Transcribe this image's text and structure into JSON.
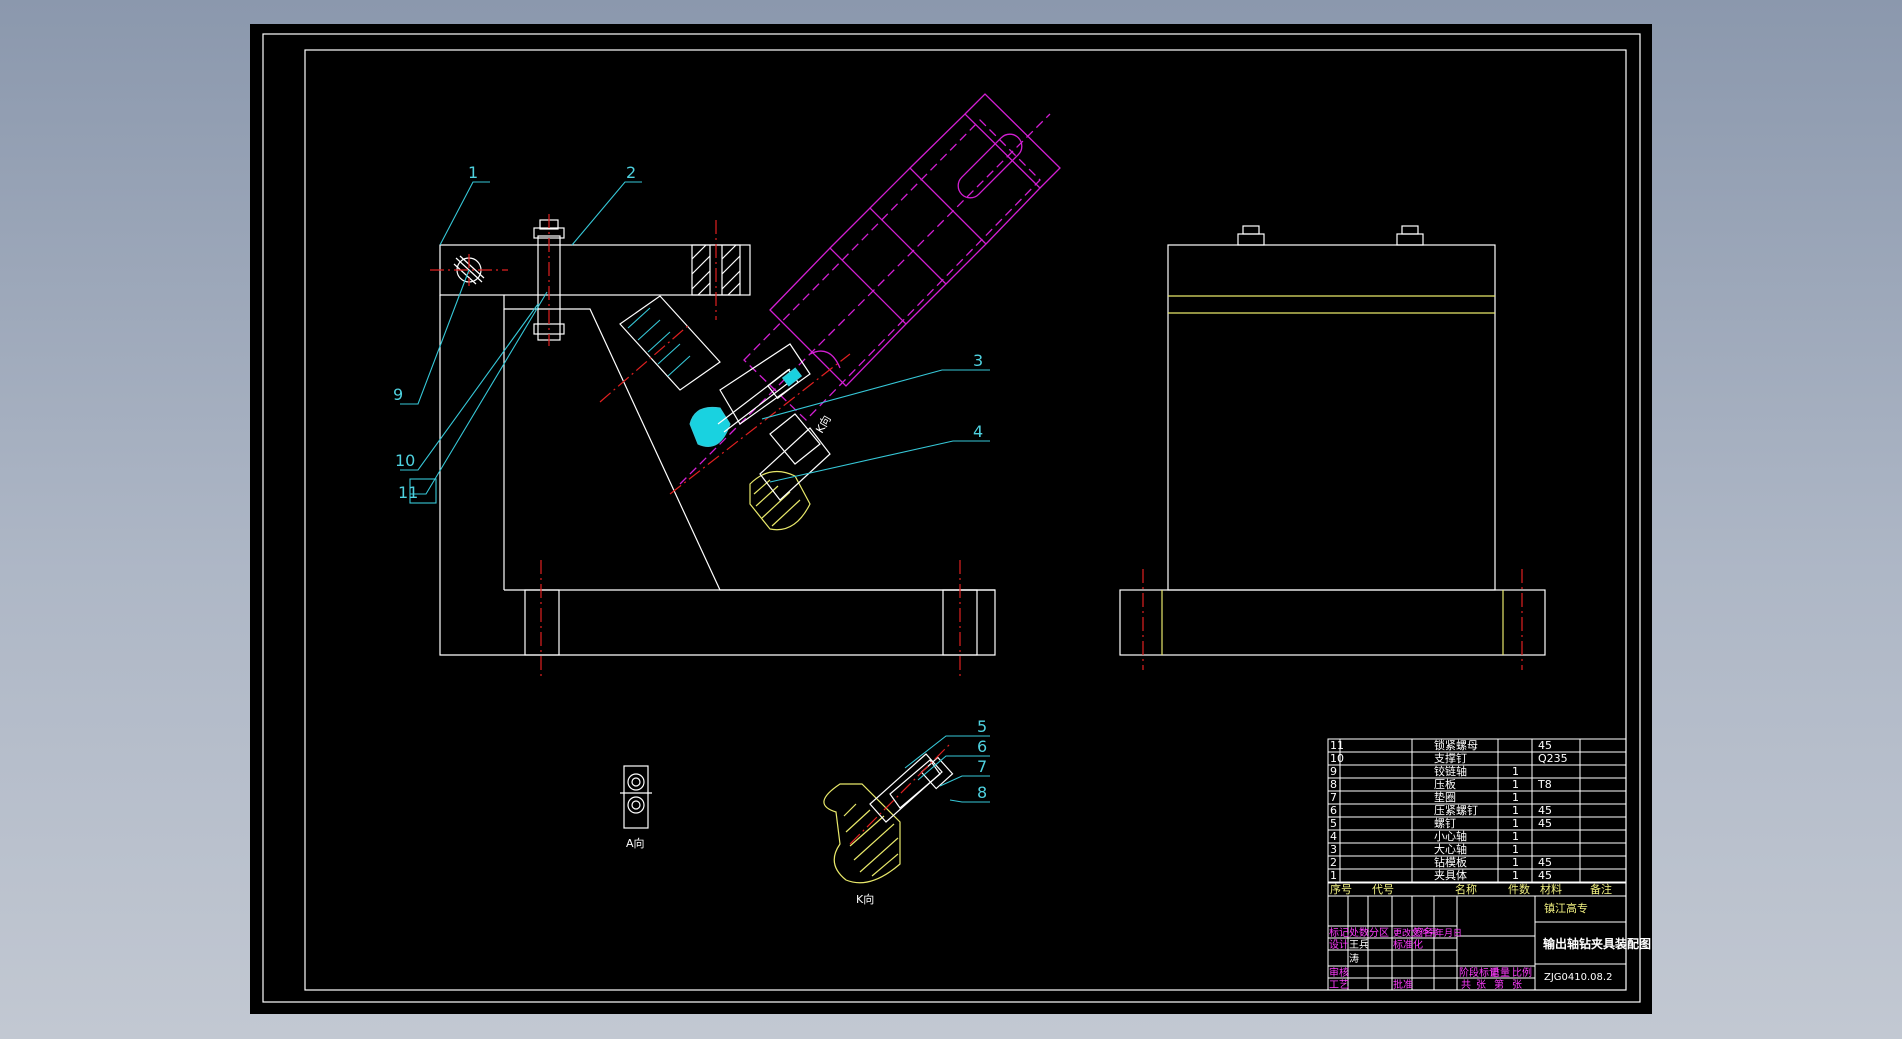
{
  "drawing": {
    "part_labels": [
      "1",
      "2",
      "3",
      "4",
      "5",
      "6",
      "7",
      "8",
      "9",
      "10",
      "11"
    ],
    "view_a_label": "A向",
    "view_k_label": "K向",
    "k_marker": "K向"
  },
  "title_block": {
    "parts": [
      {
        "no": "11",
        "name": "锁紧螺母",
        "qty": "",
        "material": "45",
        "note": ""
      },
      {
        "no": "10",
        "name": "支撑钉",
        "qty": "",
        "material": "Q235",
        "note": ""
      },
      {
        "no": "9",
        "name": "铰链轴",
        "qty": "1",
        "material": "",
        "note": ""
      },
      {
        "no": "8",
        "name": "压板",
        "qty": "1",
        "material": "T8",
        "note": ""
      },
      {
        "no": "7",
        "name": "垫圈",
        "qty": "1",
        "material": "",
        "note": ""
      },
      {
        "no": "6",
        "name": "压紧螺钉",
        "qty": "1",
        "material": "45",
        "note": ""
      },
      {
        "no": "5",
        "name": "螺钉",
        "qty": "1",
        "material": "45",
        "note": ""
      },
      {
        "no": "4",
        "name": "小心轴",
        "qty": "1",
        "material": "",
        "note": ""
      },
      {
        "no": "3",
        "name": "大心轴",
        "qty": "1",
        "material": "",
        "note": ""
      },
      {
        "no": "2",
        "name": "钻模板",
        "qty": "1",
        "material": "45",
        "note": ""
      },
      {
        "no": "1",
        "name": "夹具体",
        "qty": "1",
        "material": "45",
        "note": ""
      }
    ],
    "header": {
      "no": "序号",
      "code": "代号",
      "name": "名称",
      "qty": "件数",
      "material": "材料",
      "note": "备注"
    },
    "school": "镇江高专",
    "drawing_title": "输出轴钻夹具装配图",
    "drawing_number": "ZJG0410.08.2",
    "revision_row": [
      "标记",
      "处数",
      "分区",
      "更改文件号",
      "签名",
      "年月日"
    ],
    "role_design": "设计",
    "role_std": "标准化",
    "role_check": "审核",
    "role_process": "工艺",
    "role_approve": "批准",
    "stage_row": [
      "阶段标记",
      "重量",
      "比例"
    ],
    "sheet_row": [
      "共",
      "张",
      "第",
      "张"
    ],
    "designer": "王兵",
    "designer_2": "涛"
  },
  "colors": {
    "sheet": "#000000",
    "outline": "#ffffff",
    "centerline": "#e02020",
    "drill_bushing": "#d21fd2",
    "leader": "#36c8d8",
    "section": "#e8e86a"
  }
}
